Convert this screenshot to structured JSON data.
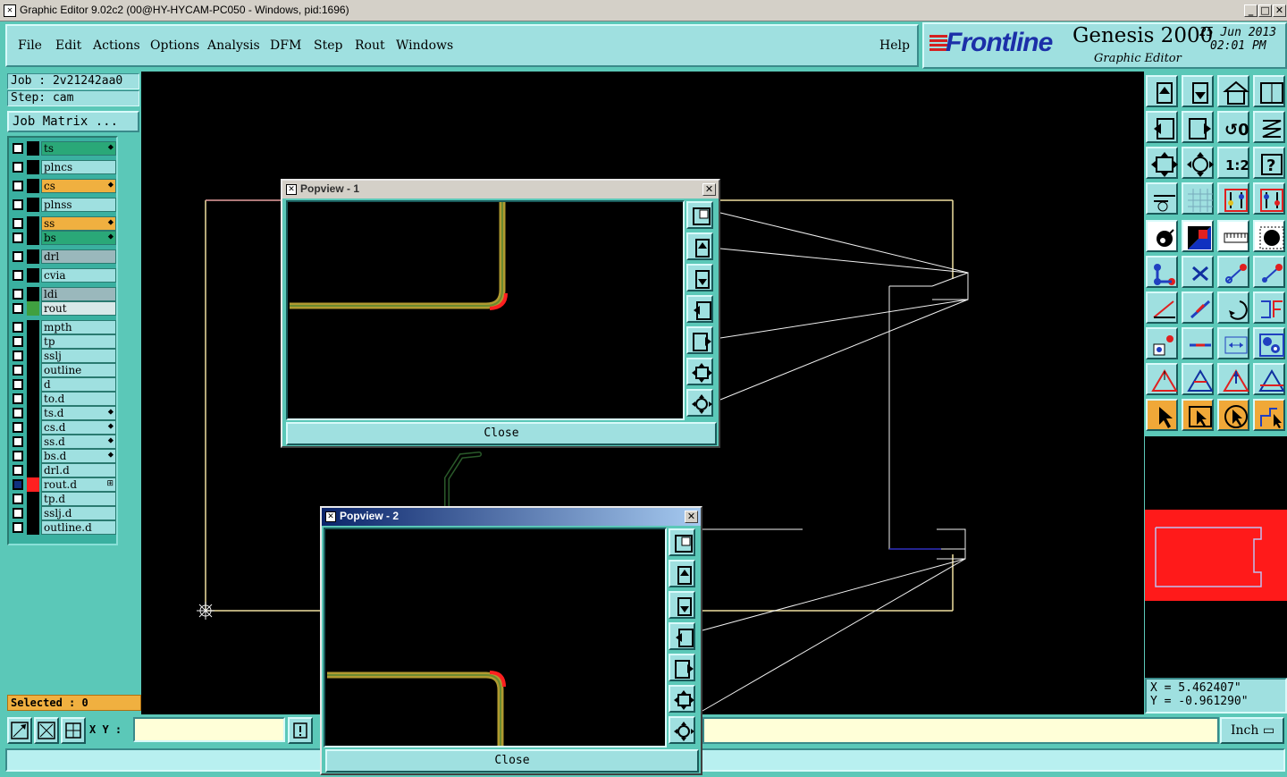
{
  "window": {
    "title": "Graphic Editor 9.02c2 (00@HY-HYCAM-PC050 - Windows, pid:1696)",
    "minimize": "_",
    "maximize": "□",
    "close": "✕"
  },
  "menu": {
    "file": "File",
    "edit": "Edit",
    "actions": "Actions",
    "options": "Options",
    "analysis": "Analysis",
    "dfm": "DFM",
    "step": "Step",
    "rout": "Rout",
    "windows": "Windows",
    "help": "Help"
  },
  "brand": {
    "logo": "Frontline",
    "product": "Genesis 2000",
    "subtitle": "Graphic Editor",
    "date": "25 Jun 2013",
    "time": "02:01 PM"
  },
  "job": {
    "job": "Job : 2v21242aa0",
    "step": "Step: cam",
    "matrix": "Job Matrix ..."
  },
  "layers": [
    {
      "name": "ts",
      "bg": "#2aa878",
      "swatch": "#000000",
      "mark": "⬥",
      "checked": false
    },
    {
      "name": "plncs",
      "bg": "#9fe0e0",
      "swatch": "#000000",
      "mark": "",
      "checked": false
    },
    {
      "name": "cs",
      "bg": "#f0b040",
      "swatch": "#000000",
      "mark": "⬥",
      "checked": false
    },
    {
      "name": "plnss",
      "bg": "#9fe0e0",
      "swatch": "#000000",
      "mark": "",
      "checked": false
    },
    {
      "name": "ss",
      "bg": "#f0b040",
      "swatch": "#000000",
      "mark": "⬥",
      "checked": false
    },
    {
      "name": "bs",
      "bg": "#2aa878",
      "swatch": "#000000",
      "mark": "⬥",
      "checked": false
    },
    {
      "name": "drl",
      "bg": "#9ab8bc",
      "swatch": "#000000",
      "mark": "",
      "checked": false
    },
    {
      "name": "cvia",
      "bg": "#9fe0e0",
      "swatch": "#000000",
      "mark": "",
      "checked": false
    },
    {
      "name": "ldi",
      "bg": "#9ab8bc",
      "swatch": "#000000",
      "mark": "",
      "checked": false
    },
    {
      "name": "rout",
      "bg": "#d8e8e8",
      "swatch": "#40a040",
      "mark": "",
      "checked": false
    },
    {
      "name": "mpth",
      "bg": "#9fe0e0",
      "swatch": "#000000",
      "mark": "",
      "checked": false
    },
    {
      "name": "tp",
      "bg": "#9fe0e0",
      "swatch": "#000000",
      "mark": "",
      "checked": false
    },
    {
      "name": "sslj",
      "bg": "#9fe0e0",
      "swatch": "#000000",
      "mark": "",
      "checked": false
    },
    {
      "name": "outline",
      "bg": "#9fe0e0",
      "swatch": "#000000",
      "mark": "",
      "checked": false
    },
    {
      "name": "d",
      "bg": "#9fe0e0",
      "swatch": "#000000",
      "mark": "",
      "checked": false
    },
    {
      "name": "to.d",
      "bg": "#9fe0e0",
      "swatch": "#000000",
      "mark": "",
      "checked": false
    },
    {
      "name": "ts.d",
      "bg": "#9fe0e0",
      "swatch": "#000000",
      "mark": "⬥",
      "checked": false
    },
    {
      "name": "cs.d",
      "bg": "#9fe0e0",
      "swatch": "#000000",
      "mark": "⬥",
      "checked": false
    },
    {
      "name": "ss.d",
      "bg": "#9fe0e0",
      "swatch": "#000000",
      "mark": "⬥",
      "checked": false
    },
    {
      "name": "bs.d",
      "bg": "#9fe0e0",
      "swatch": "#000000",
      "mark": "⬥",
      "checked": false
    },
    {
      "name": "drl.d",
      "bg": "#9fe0e0",
      "swatch": "#000000",
      "mark": "",
      "checked": false
    },
    {
      "name": "rout.d",
      "bg": "#9fe0e0",
      "swatch": "#ff2020",
      "mark": "⊞",
      "checked": true
    },
    {
      "name": "tp.d",
      "bg": "#9fe0e0",
      "swatch": "#000000",
      "mark": "",
      "checked": false
    },
    {
      "name": "sslj.d",
      "bg": "#9fe0e0",
      "swatch": "#000000",
      "mark": "",
      "checked": false
    },
    {
      "name": "outline.d",
      "bg": "#9fe0e0",
      "swatch": "#000000",
      "mark": "",
      "checked": false
    }
  ],
  "selected": "Selected : 0",
  "coords": {
    "x": "X = 5.462407\"",
    "y": "Y = -0.961290\""
  },
  "bottom": {
    "xy_label": "X Y :",
    "xy_value": "",
    "units": "Inch ▭"
  },
  "popview1": {
    "title": "Popview - 1",
    "close": "Close"
  },
  "popview2": {
    "title": "Popview - 2",
    "close": "Close"
  },
  "colors": {
    "panel": "#5bc8b8",
    "button": "#9fe0e0",
    "trace_yellow": "#b09a30",
    "trace_green": "#4a8a3a",
    "rout_red": "#ff2020",
    "outline_line": "#f0e8c0"
  }
}
